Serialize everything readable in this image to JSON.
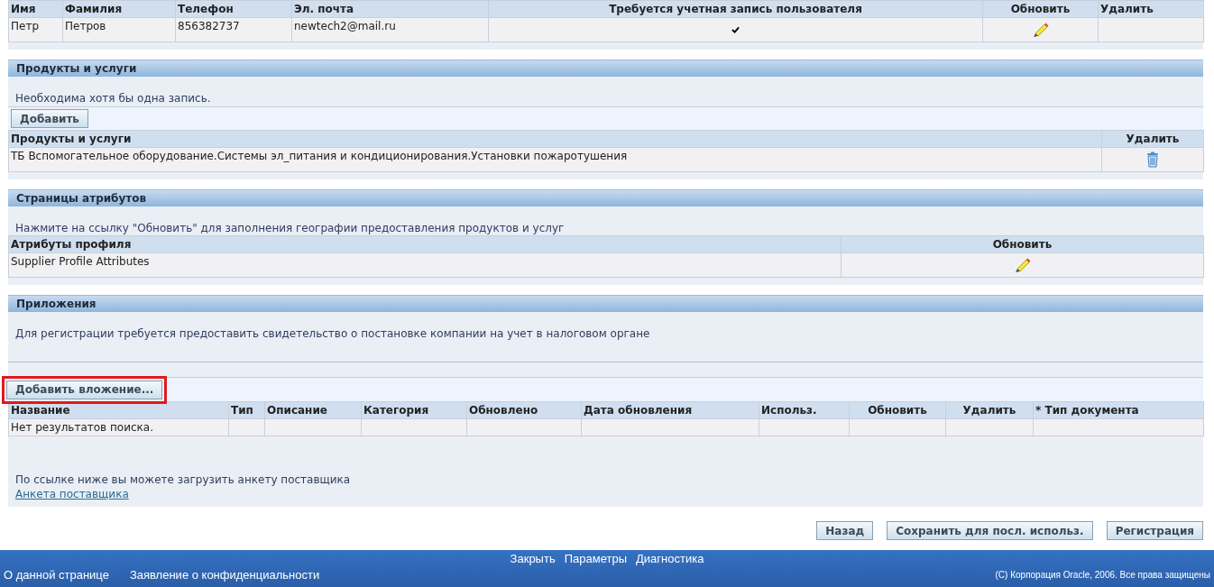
{
  "contacts": {
    "columns": [
      "Имя",
      "Фамилия",
      "Телефон",
      "Эл. почта",
      "Требуется учетная запись пользователя",
      "Обновить",
      "Удалить"
    ],
    "rows": [
      {
        "first_name": "Петр",
        "last_name": "Петров",
        "phone": "856382737",
        "email": "newtech2@mail.ru",
        "account_required": true
      }
    ]
  },
  "products": {
    "title": "Продукты и услуги",
    "note": "Необходима хотя бы одна запись.",
    "add_button": "Добавить",
    "columns": [
      "Продукты и услуги",
      "Удалить"
    ],
    "rows": [
      {
        "name": "ТБ Вспомогательное оборудование.Системы эл_питания и кондиционирования.Установки пожаротушения"
      }
    ]
  },
  "attributes": {
    "title": "Страницы атрибутов",
    "note": "Нажмите на ссылку \"Обновить\" для заполнения географии предоставления продуктов и услуг",
    "columns": [
      "Атрибуты профиля",
      "Обновить"
    ],
    "rows": [
      {
        "name": "Supplier Profile Attributes"
      }
    ]
  },
  "attachments": {
    "title": "Приложения",
    "note": "Для регистрации требуется предоставить свидетельство о постановке компании на учет в налоговом органе",
    "add_button": "Добавить вложение...",
    "add_button_highlighted": true,
    "columns": [
      "Название",
      "Тип",
      "Описание",
      "Категория",
      "Обновлено",
      "Дата обновления",
      "Использ.",
      "Обновить",
      "Удалить",
      "* Тип документа"
    ],
    "empty_text": "Нет результатов поиска.",
    "download_note": "По ссылке ниже вы можете загрузить анкету поставщика",
    "download_link": "Анкета поставщика"
  },
  "buttons": [
    "Назад",
    "Сохранить для посл. использ.",
    "Регистрация"
  ],
  "footer": {
    "links": [
      "Закрыть",
      "Параметры",
      "Диагностика"
    ],
    "bottom_links": [
      "О данной странице",
      "Заявление о конфиденциальности"
    ],
    "copyright": "(C) Корпорация Oracle, 2006. Все права защищены"
  }
}
